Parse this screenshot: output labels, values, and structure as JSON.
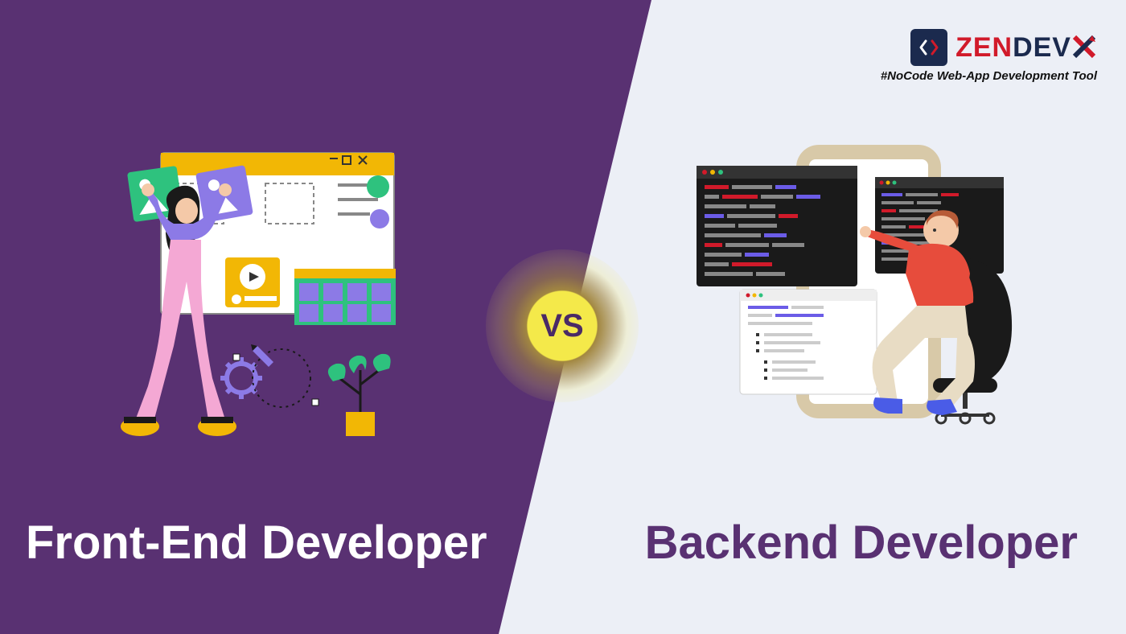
{
  "logo": {
    "part1": "ZEN",
    "part2": "DEV",
    "part3": "X",
    "tagline": "#NoCode Web-App Development Tool"
  },
  "vs": "VS",
  "left_title": "Front-End Developer",
  "right_title": "Backend Developer",
  "colors": {
    "purple": "#593172",
    "light": "#eceff6",
    "yellow": "#f4e94a",
    "red": "#d11a2a",
    "navy": "#1b2a4e"
  }
}
